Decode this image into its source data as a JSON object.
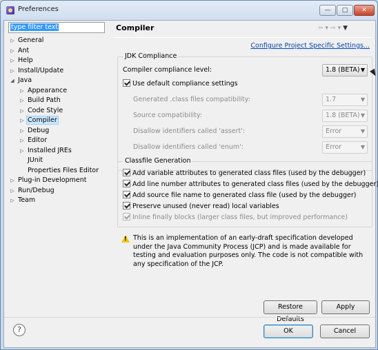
{
  "window": {
    "title": "Preferences",
    "min_icon": "minimize-icon",
    "max_icon": "maximize-icon",
    "close_icon": "close-icon"
  },
  "filter": {
    "value": "type filter text"
  },
  "tree": [
    {
      "label": "General",
      "expander": "▷"
    },
    {
      "label": "Ant",
      "expander": "▷"
    },
    {
      "label": "Help",
      "expander": "▷"
    },
    {
      "label": "Install/Update",
      "expander": "▷"
    },
    {
      "label": "Java",
      "expander": "◢"
    },
    {
      "label": "Appearance",
      "expander": "▷"
    },
    {
      "label": "Build Path",
      "expander": "▷"
    },
    {
      "label": "Code Style",
      "expander": "▷"
    },
    {
      "label": "Compiler",
      "expander": "▷"
    },
    {
      "label": "Debug",
      "expander": "▷"
    },
    {
      "label": "Editor",
      "expander": "▷"
    },
    {
      "label": "Installed JREs",
      "expander": "▷"
    },
    {
      "label": "JUnit",
      "expander": ""
    },
    {
      "label": "Properties Files Editor",
      "expander": ""
    },
    {
      "label": "Plug-in Development",
      "expander": "▷"
    },
    {
      "label": "Run/Debug",
      "expander": "▷"
    },
    {
      "label": "Team",
      "expander": "▷"
    }
  ],
  "page": {
    "title": "Compiler",
    "configure_link": "Configure Project Specific Settings...",
    "nav": {
      "back": "⇦",
      "back_menu": "▾",
      "forward": "⇨",
      "forward_menu": "▾",
      "view_menu": "▼"
    }
  },
  "jdk": {
    "title": "JDK Compliance",
    "compliance_label": "Compiler compliance level:",
    "compliance_value": "1.8 (BETA)",
    "use_default_label": "Use default compliance settings",
    "use_default_checked": true,
    "generated_label": "Generated .class files compatibility:",
    "generated_value": "1.7",
    "source_label": "Source compatibility:",
    "source_value": "1.8 (BETA)",
    "assert_label": "Disallow identifiers called 'assert':",
    "assert_value": "Error",
    "enum_label": "Disallow identifiers called 'enum':",
    "enum_value": "Error"
  },
  "classfile": {
    "title": "Classfile Generation",
    "items": [
      {
        "label": "Add variable attributes to generated class files (used by the debugger)",
        "checked": true,
        "enabled": true
      },
      {
        "label": "Add line number attributes to generated class files (used by the debugger)",
        "checked": true,
        "enabled": true
      },
      {
        "label": "Add source file name to generated class file (used by the debugger)",
        "checked": true,
        "enabled": true
      },
      {
        "label": "Preserve unused (never read) local variables",
        "checked": true,
        "enabled": true
      },
      {
        "label": "Inline finally blocks (larger class files, but improved performance)",
        "checked": true,
        "enabled": false
      }
    ]
  },
  "warning_text": "This is an implementation of an early-draft specification developed under the Java Community Process (JCP) and is made available for testing and evaluation purposes only. The code is not compatible with any specification of the JCP.",
  "buttons": {
    "restore_defaults": "Restore Defaults",
    "apply": "Apply",
    "ok": "OK",
    "cancel": "Cancel",
    "help": "?"
  }
}
